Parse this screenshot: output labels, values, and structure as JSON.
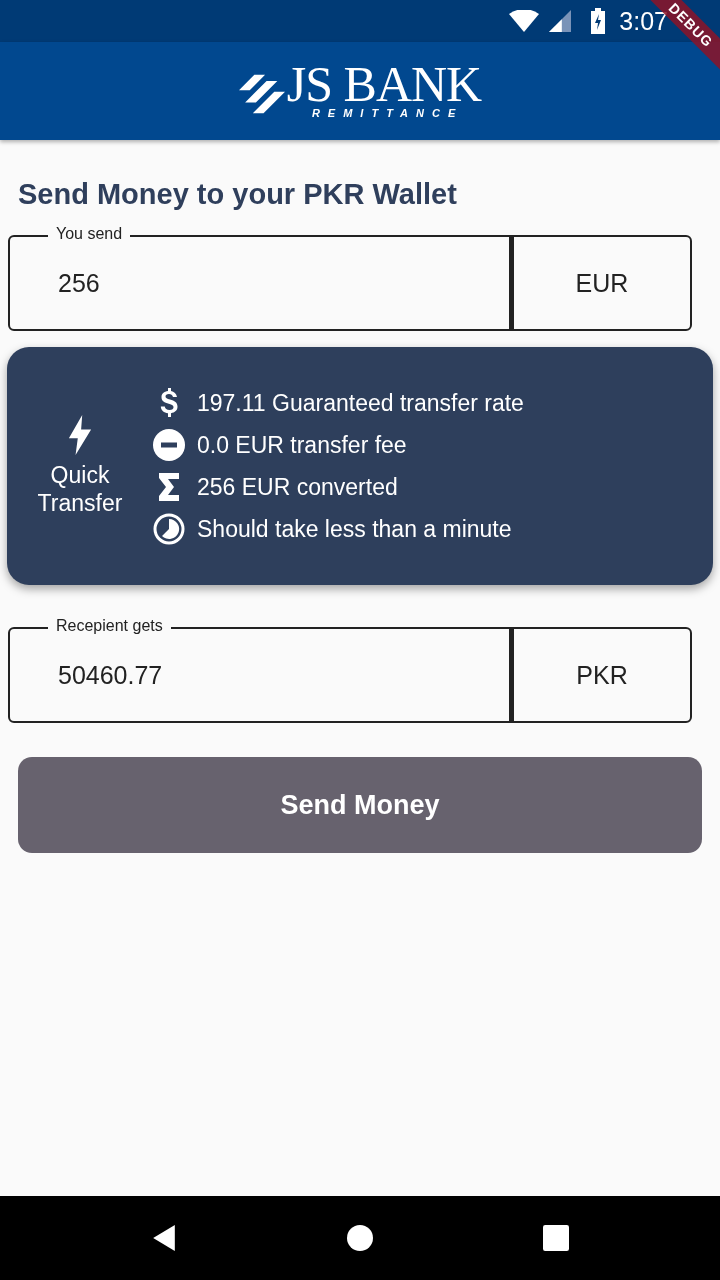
{
  "status_bar": {
    "time": "3:07"
  },
  "debug_banner": "DEBUG",
  "header": {
    "logo_title": "JS BANK",
    "logo_subtitle": "REMITTANCE"
  },
  "title": "Send Money to your PKR Wallet",
  "send": {
    "label": "You send",
    "value": "256",
    "currency": "EUR"
  },
  "quote": {
    "speed_label": "Quick Transfer",
    "features": [
      {
        "kind": "rate",
        "text": "197.11 Guaranteed transfer rate"
      },
      {
        "kind": "fee",
        "text": "0.0 EUR transfer fee"
      },
      {
        "kind": "total",
        "text": "256 EUR converted"
      },
      {
        "kind": "time",
        "text": "Should take less than a minute"
      }
    ]
  },
  "receive": {
    "label": "Recepient gets",
    "value": "50460.77",
    "currency": "PKR"
  },
  "send_button": "Send Money"
}
